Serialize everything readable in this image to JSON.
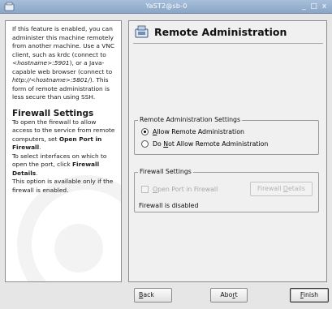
{
  "window": {
    "title": "YaST2@sb-0",
    "controls": {
      "minimize": "_",
      "maximize": "□",
      "close": "x"
    }
  },
  "help": {
    "p1_a": "If this feature is enabled, you can administer this machine remotely from another machine. Use a VNC client, such as krdc (connect to ",
    "p1_a_em": "<hostname>:5901",
    "p1_b": "), or a Java-capable web browser (connect to ",
    "p1_b_em": "http://<hostname>:5801/",
    "p1_c": "). This form of remote administration is less secure than using SSH.",
    "heading": "Firewall Settings",
    "p2_a": "To open the firewall to allow access to the service from remote computers, set ",
    "p2_a_b": "Open Port in Firewall",
    "p2_b": ".",
    "p3_a": "To select interfaces on which to open the port, click ",
    "p3_a_b": "Firewall Details",
    "p3_b": ".",
    "p4": "This option is available only if the firewall is enabled."
  },
  "main": {
    "title": "Remote Administration",
    "remote_settings": {
      "legend": "Remote Administration Settings",
      "allow": {
        "key": "A",
        "rest": "llow Remote Administration",
        "selected": true
      },
      "deny": {
        "pre": "Do ",
        "key": "N",
        "rest": "ot Allow Remote Administration",
        "selected": false
      }
    },
    "firewall": {
      "legend": "Firewall Settings",
      "open_port": {
        "key": "O",
        "rest": "pen Port in Firewall",
        "checked": false,
        "enabled": false
      },
      "details_button": {
        "pre": "Firewall ",
        "key": "D",
        "rest": "etails",
        "enabled": false
      },
      "status": "Firewall is disabled"
    }
  },
  "buttons": {
    "back": {
      "key": "B",
      "rest": "ack"
    },
    "abort": {
      "pre": "Abo",
      "key": "r",
      "rest": "t"
    },
    "finish": {
      "key": "F",
      "rest": "inish"
    }
  }
}
